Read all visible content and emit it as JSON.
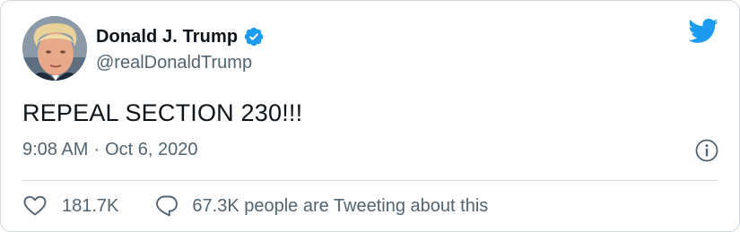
{
  "author": {
    "display_name": "Donald J. Trump",
    "handle": "@realDonaldTrump",
    "verified": true,
    "avatar_icon": "avatar-photo"
  },
  "tweet": {
    "text": "REPEAL SECTION 230!!!",
    "time": "9:08 AM",
    "separator": "·",
    "date": "Oct 6, 2020"
  },
  "actions": {
    "like_count": "181.7K",
    "reply_label": "67.3K people are Tweeting about this"
  },
  "icons": {
    "brand": "twitter-bird-icon",
    "verified": "verified-badge-icon",
    "info": "info-icon",
    "like": "heart-icon",
    "reply": "speech-bubble-icon"
  },
  "colors": {
    "brand_blue": "#1d9bf0",
    "text_primary": "#0f1419",
    "text_secondary": "#536471",
    "border": "#cfd9de"
  }
}
